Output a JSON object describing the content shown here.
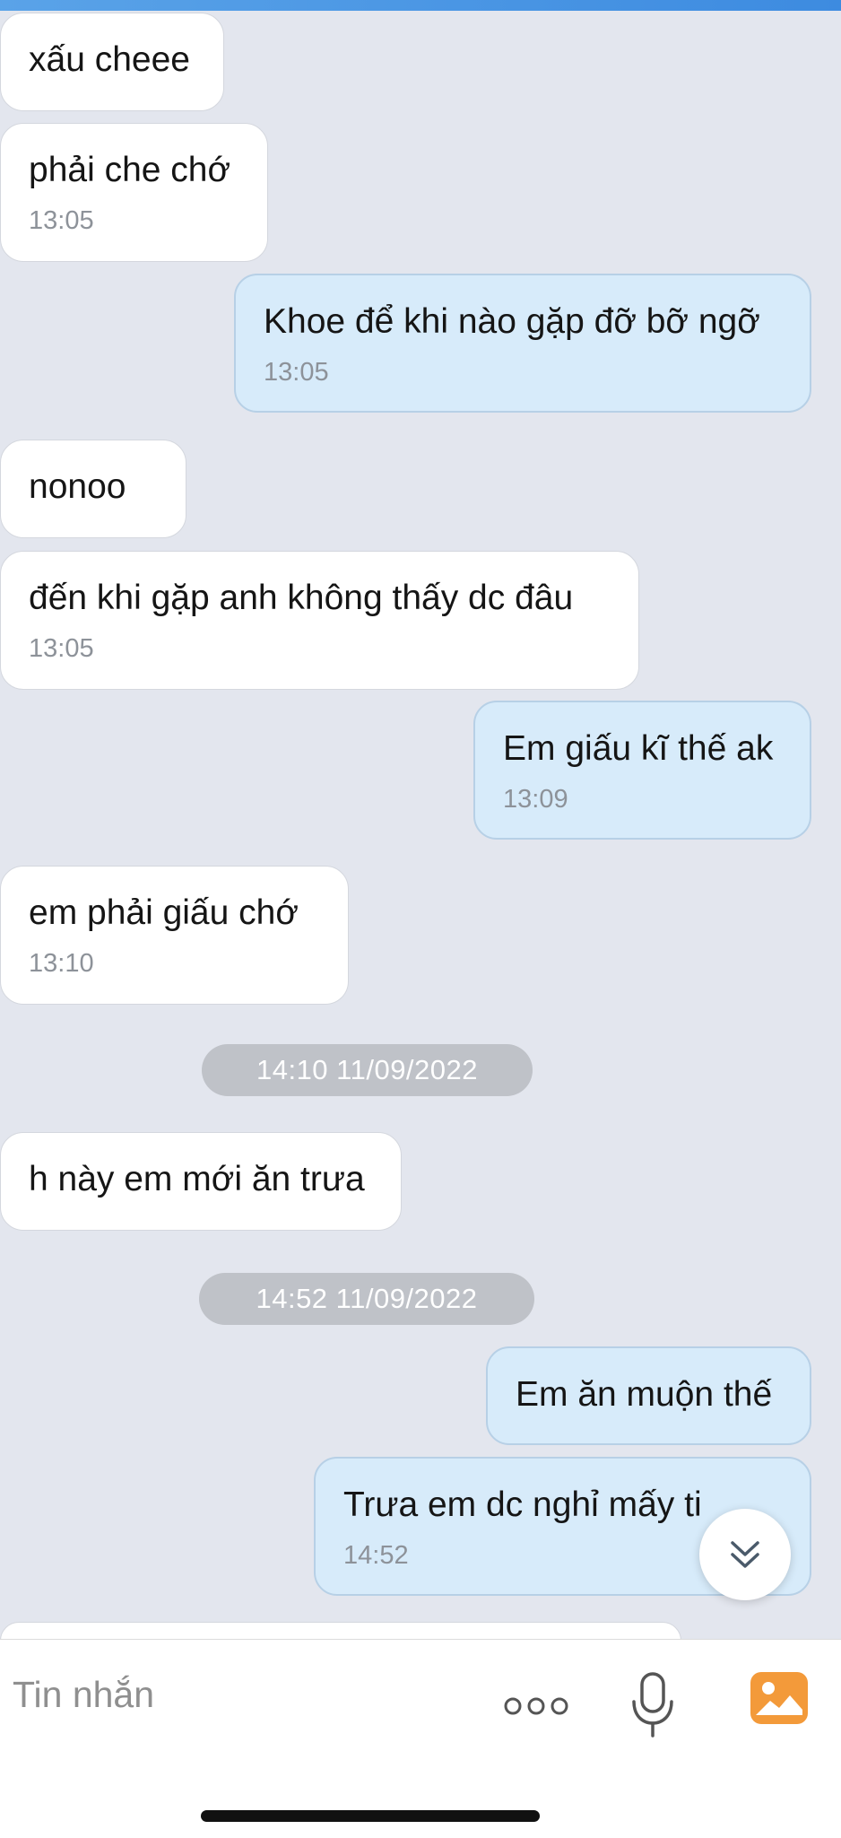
{
  "messages": [
    {
      "dir": "in",
      "text": "xấu cheee",
      "time": ""
    },
    {
      "dir": "in",
      "text": "phải che chớ",
      "time": "13:05"
    },
    {
      "dir": "out",
      "text": "Khoe để khi nào gặp đỡ bỡ ngỡ",
      "time": "13:05"
    },
    {
      "dir": "in",
      "text": "nonoo",
      "time": ""
    },
    {
      "dir": "in",
      "text": "đến khi gặp anh không thấy dc đâu",
      "time": "13:05"
    },
    {
      "dir": "out",
      "text": "Em giấu kĩ thế ak",
      "time": "13:09"
    },
    {
      "dir": "in",
      "text": "em phải giấu  chớ",
      "time": "13:10"
    },
    {
      "dir": "in",
      "text": "h này em mới ăn trưa",
      "time": ""
    },
    {
      "dir": "out",
      "text": "Em ăn muộn thế",
      "time": ""
    },
    {
      "dir": "out",
      "text": "Trưa em dc nghỉ mấy ti",
      "time": "14:52"
    }
  ],
  "date_separators": [
    {
      "label": "14:10 11/09/2022"
    },
    {
      "label": "14:52 11/09/2022"
    }
  ],
  "composer": {
    "placeholder": "Tin nhắn",
    "icons": [
      "more-icon",
      "microphone-icon",
      "image-icon"
    ]
  },
  "scroll_button": {
    "icon": "double-chevron-down-icon"
  },
  "colors": {
    "background": "#e3e6ee",
    "incoming_bubble": "#ffffff",
    "outgoing_bubble": "#d7ebfa",
    "date_pill": "#bfc2c8",
    "accent_image_icon": "#f39a3a"
  }
}
